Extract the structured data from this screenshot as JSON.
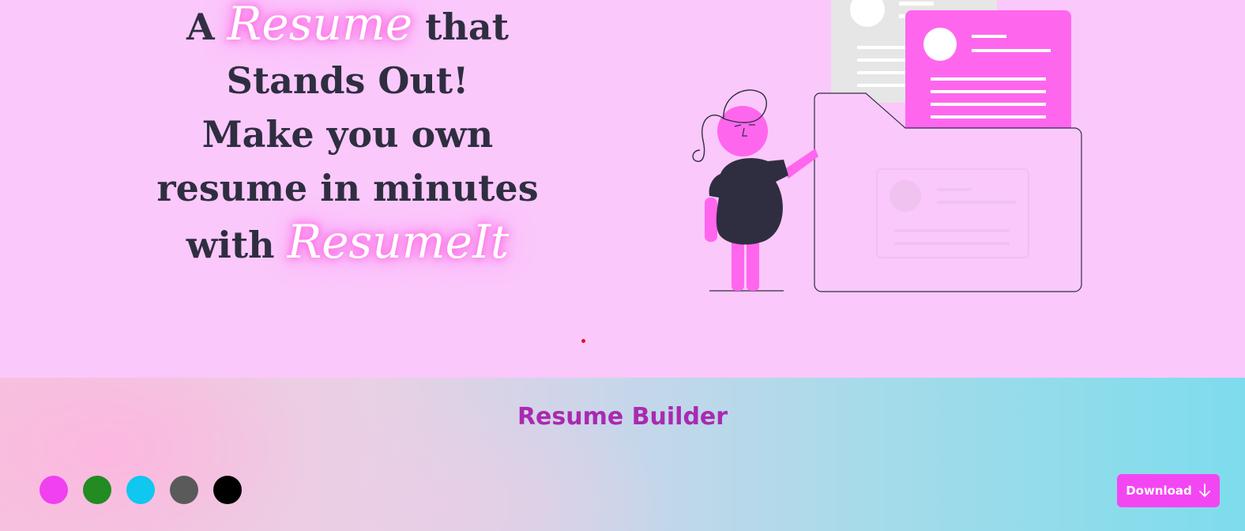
{
  "hero": {
    "line1_pre": "A",
    "line1_script": "Resume",
    "line1_post": "that",
    "line2": "Stands Out!",
    "line3": "Make you own",
    "line4": "resume in minutes",
    "line5_pre": "with",
    "line5_script": "ResumeIt"
  },
  "footer": {
    "brand": "Resume Builder",
    "swatches": [
      {
        "name": "magenta",
        "color": "#f040f0"
      },
      {
        "name": "green",
        "color": "#228b22"
      },
      {
        "name": "cyan",
        "color": "#0fc7ef"
      },
      {
        "name": "gray",
        "color": "#5a5a5a"
      },
      {
        "name": "black",
        "color": "#000000"
      }
    ],
    "download_label": "Download",
    "download_icon": "arrow-down-icon"
  },
  "colors": {
    "hero_bg": "#fbc8fb",
    "heading": "#2f2e41",
    "accent": "#ff66ee",
    "brand": "#a92ab0",
    "button": "#f346f2"
  }
}
